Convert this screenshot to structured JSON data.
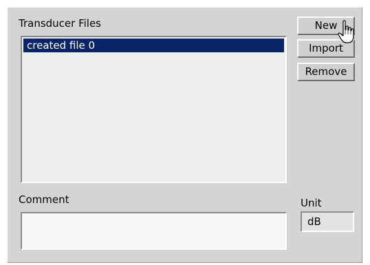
{
  "transducer_files": {
    "label": "Transducer Files",
    "items": [
      {
        "name": "created file 0",
        "selected": true
      }
    ]
  },
  "buttons": {
    "new": "New",
    "import": "Import",
    "remove": "Remove"
  },
  "comment": {
    "label": "Comment",
    "value": ""
  },
  "unit": {
    "label": "Unit",
    "value": "dB"
  },
  "colors": {
    "selection": "#0a246a",
    "panel": "#d4d4d4"
  },
  "cursor_icon": "hand-pointer-icon"
}
